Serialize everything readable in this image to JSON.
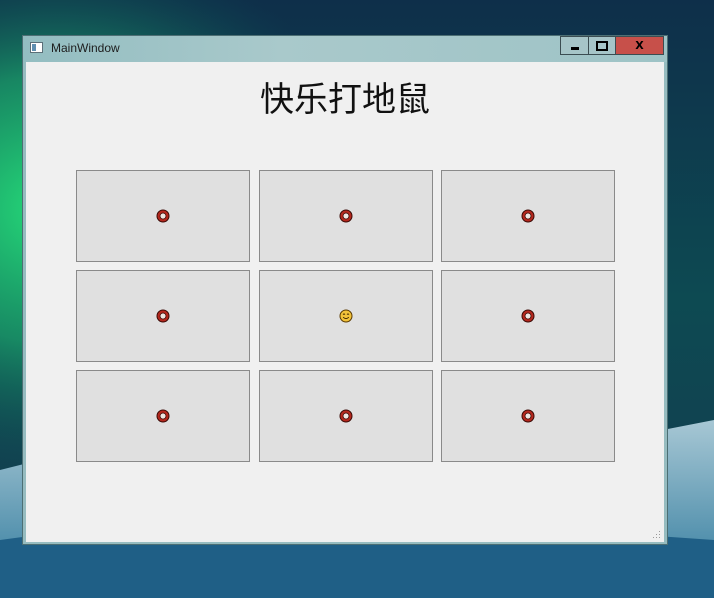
{
  "window": {
    "title": "MainWindow",
    "controls": {
      "minimize": "",
      "maximize": "",
      "close": "X"
    }
  },
  "game": {
    "heading": "快乐打地鼠",
    "holes": [
      {
        "state": "empty",
        "icon": "ring-icon"
      },
      {
        "state": "empty",
        "icon": "ring-icon"
      },
      {
        "state": "empty",
        "icon": "ring-icon"
      },
      {
        "state": "empty",
        "icon": "ring-icon"
      },
      {
        "state": "mole",
        "icon": "smiley-mole-icon"
      },
      {
        "state": "empty",
        "icon": "ring-icon"
      },
      {
        "state": "empty",
        "icon": "ring-icon"
      },
      {
        "state": "empty",
        "icon": "ring-icon"
      },
      {
        "state": "empty",
        "icon": "ring-icon"
      }
    ]
  },
  "colors": {
    "client_bg": "#f0f0f0",
    "hole_bg": "#e0e0e0",
    "ring_outer": "#b5281e",
    "mole_face": "#f2c23a",
    "close_button": "#c7504a"
  }
}
